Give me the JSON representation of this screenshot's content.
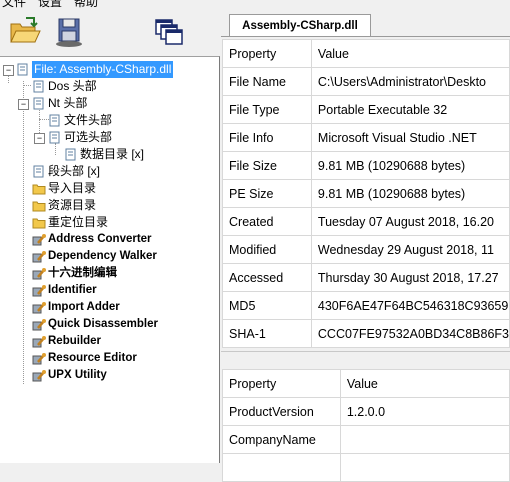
{
  "menu": {
    "items": [
      "文件",
      "设置",
      "帮助"
    ]
  },
  "toolbar": {
    "buttons": [
      {
        "icon": "open-folder-icon"
      },
      {
        "icon": "save-disk-icon"
      },
      {
        "icon": "cascade-windows-icon"
      }
    ]
  },
  "tree": {
    "root": {
      "label": "File: Assembly-CSharp.dll",
      "expander": "−"
    },
    "dos_header": "Dos 头部",
    "nt_header": {
      "label": "Nt 头部",
      "expander": "−"
    },
    "file_header": "文件头部",
    "optional_header": {
      "label": "可选头部",
      "expander": "−"
    },
    "data_directories": "数据目录 [x]",
    "section_header": "段头部 [x]",
    "import_dir": "导入目录",
    "resource_dir": "资源目录",
    "reloc_dir": "重定位目录",
    "tools": [
      "Address Converter",
      "Dependency Walker",
      "十六进制编辑",
      "Identifier",
      "Import Adder",
      "Quick Disassembler",
      "Rebuilder",
      "Resource Editor",
      "UPX Utility"
    ]
  },
  "tab": {
    "label": "Assembly-CSharp.dll"
  },
  "grid1": {
    "headers": [
      "Property",
      "Value"
    ],
    "rows": [
      [
        "File Name",
        "C:\\Users\\Administrator\\Deskto"
      ],
      [
        "File Type",
        "Portable Executable 32"
      ],
      [
        "File Info",
        "Microsoft Visual Studio .NET"
      ],
      [
        "File Size",
        "9.81 MB (10290688 bytes)"
      ],
      [
        "PE Size",
        "9.81 MB (10290688 bytes)"
      ],
      [
        "Created",
        "Tuesday 07 August 2018, 16.20"
      ],
      [
        "Modified",
        "Wednesday 29 August 2018, 11"
      ],
      [
        "Accessed",
        "Thursday 30 August 2018, 17.27"
      ],
      [
        "MD5",
        "430F6AE47F64BC546318C93659"
      ],
      [
        "SHA-1",
        "CCC07FE97532A0BD34C8B86F3"
      ]
    ]
  },
  "grid2": {
    "headers": [
      "Property",
      "Value"
    ],
    "rows": [
      [
        "ProductVersion",
        "1.2.0.0"
      ],
      [
        "CompanyName",
        ""
      ]
    ]
  },
  "colors": {
    "selection": "#3399ff",
    "window": "#f0f0f0"
  }
}
